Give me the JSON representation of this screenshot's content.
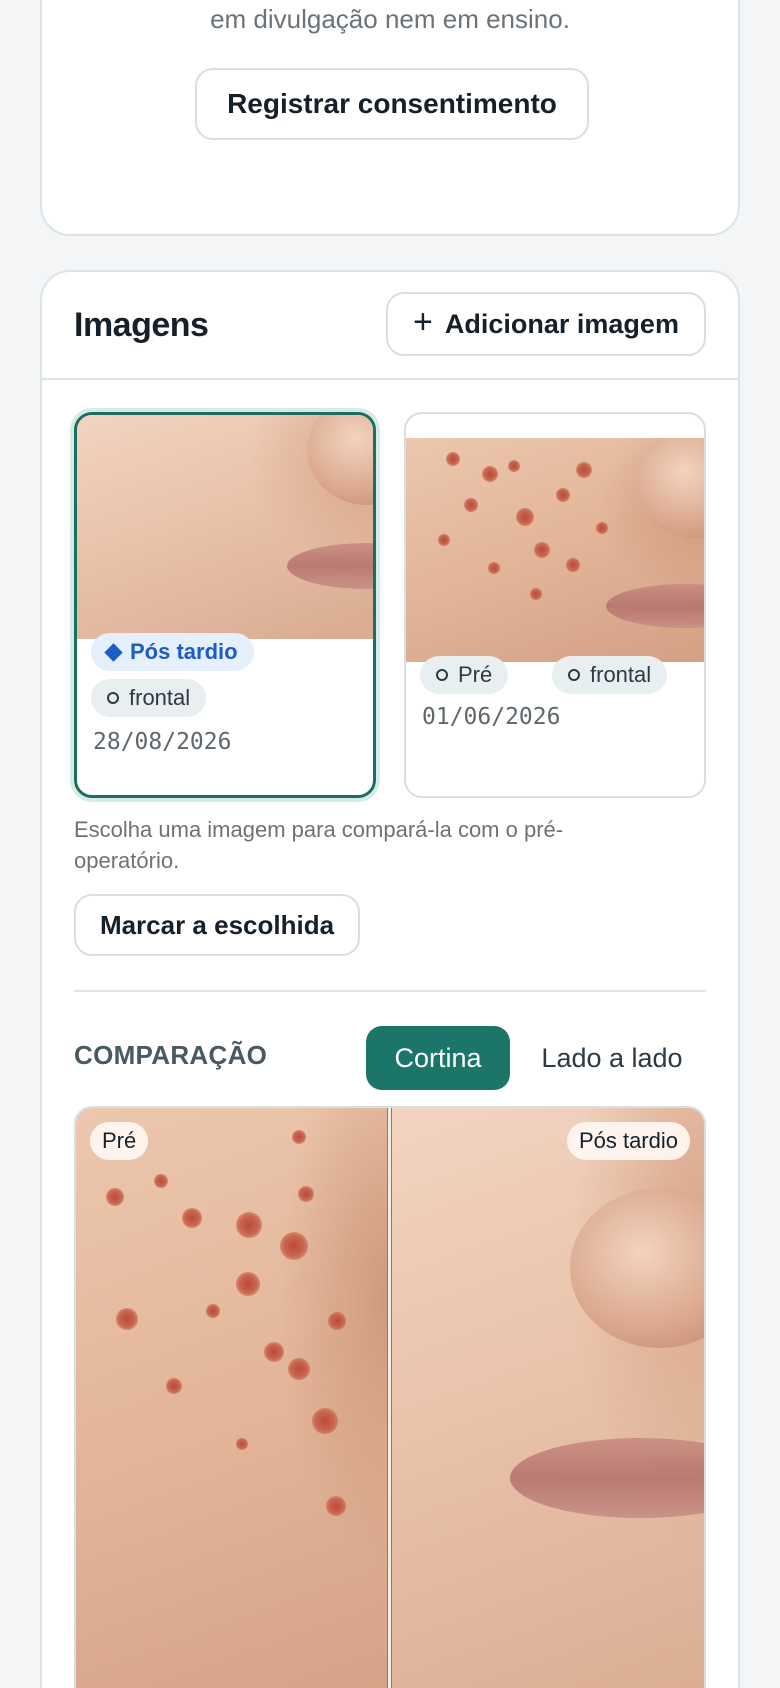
{
  "consent": {
    "text": "em divulgação nem em ensino.",
    "button": "Registrar consentimento"
  },
  "images": {
    "title": "Imagens",
    "add_button": "Adicionar imagem",
    "add_icon": "plus-icon",
    "items": [
      {
        "phase": "Pós tardio",
        "view": "frontal",
        "date": "28/08/2026",
        "selected": true
      },
      {
        "phase": "Pré",
        "view": "frontal",
        "date": "01/06/2026",
        "selected": false
      }
    ],
    "hint": "Escolha uma imagem para compará-la com o pré-operatório.",
    "mark_button": "Marcar a escolhida"
  },
  "comparison": {
    "title": "COMPARAÇÃO",
    "modes": [
      "Cortina",
      "Lado a lado"
    ],
    "active_mode": "Cortina",
    "left_label": "Pré",
    "right_label": "Pós tardio"
  },
  "colors": {
    "accent": "#1b7568",
    "selected_border": "#1b6e62",
    "phase_blue": "#1c5cc6"
  }
}
